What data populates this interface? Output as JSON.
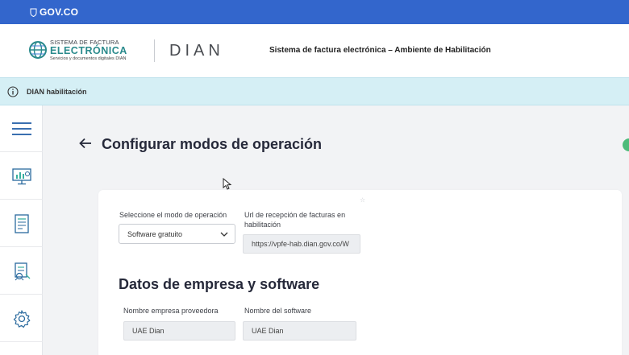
{
  "gov_bar": {
    "label": "GOV.CO"
  },
  "header": {
    "logo_line1": "SISTEMA DE FACTURA",
    "logo_line2": "ELECTRÓNICA",
    "logo_line3": "Servicios y documentos digitales DIAN",
    "dian_logo": "DIAN",
    "title": "Sistema de factura electrónica – Ambiente de Habilitación"
  },
  "environment_bar": {
    "label": "DIAN habilitación"
  },
  "sidebar": {
    "items": [
      {
        "icon": "hamburger-menu-icon"
      },
      {
        "icon": "monitor-chart-icon"
      },
      {
        "icon": "document-list-icon"
      },
      {
        "icon": "document-stamp-icon"
      },
      {
        "icon": "gear-icon"
      }
    ]
  },
  "page": {
    "title": "Configurar modos de operación"
  },
  "operation_mode": {
    "mode_label": "Seleccione el modo de operación",
    "mode_value": "Software gratuito",
    "url_label_line1": "Url de recepción de facturas en",
    "url_label_line2": "habilitación",
    "url_value": "https://vpfe-hab.dian.gov.co/W"
  },
  "company_section": {
    "title": "Datos de empresa y software",
    "provider_label": "Nombre empresa proveedora",
    "provider_value": "UAE Dian",
    "software_label": "Nombre del software",
    "software_value": "UAE Dian"
  },
  "colors": {
    "gov_blue": "#3366cc",
    "env_bar": "#d5eff5",
    "brand_teal": "#2a8a8c",
    "status_green": "#4dbb7a"
  }
}
